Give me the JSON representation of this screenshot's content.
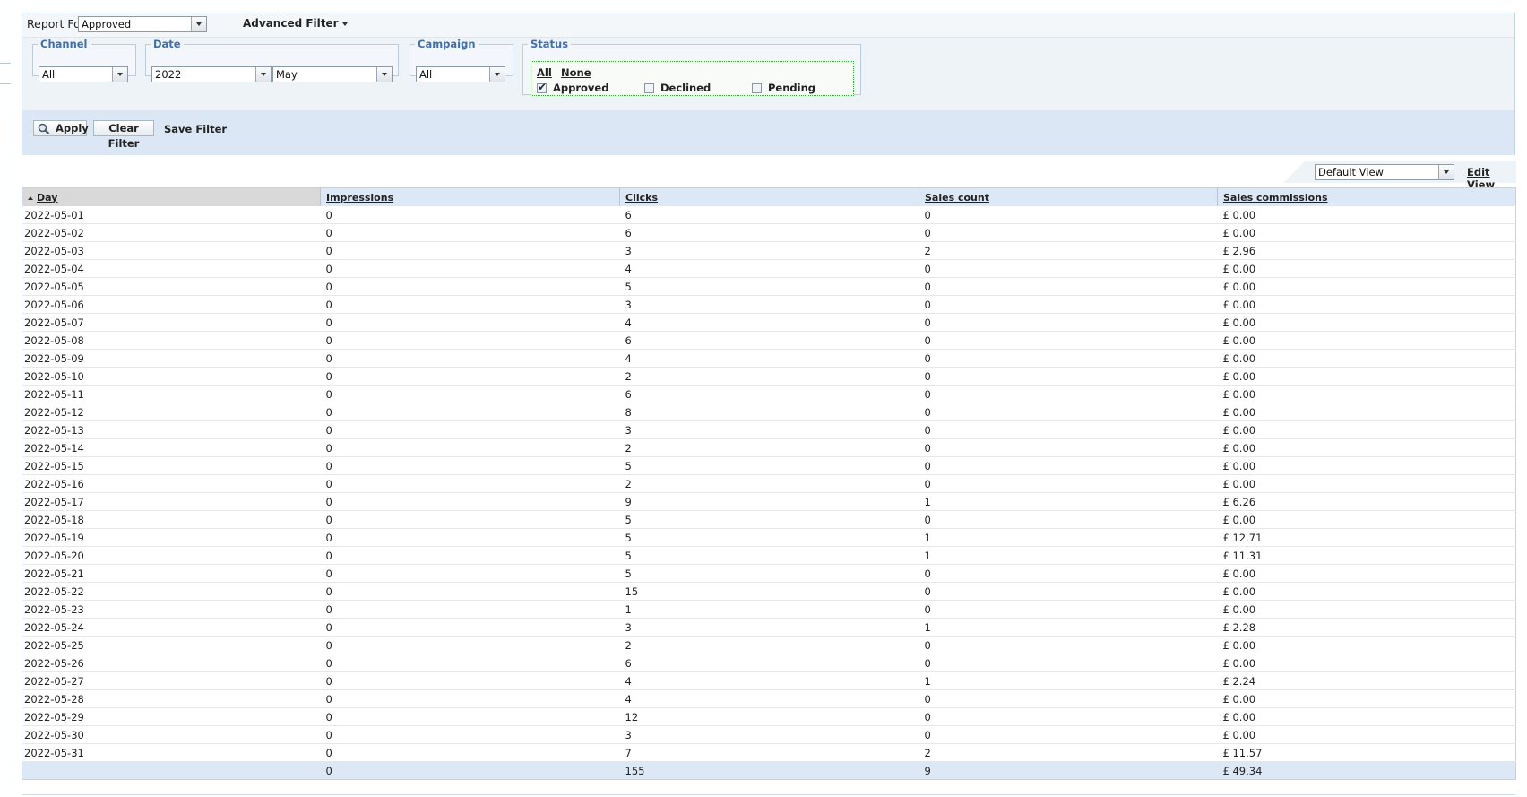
{
  "filter": {
    "report_for_label": "Report For",
    "report_for_value": "Approved",
    "advanced_filter_label": "Advanced Filter",
    "channel": {
      "legend": "Channel",
      "value": "All"
    },
    "date": {
      "legend": "Date",
      "year": "2022",
      "month": "May"
    },
    "campaign": {
      "legend": "Campaign",
      "value": "All"
    },
    "status": {
      "legend": "Status",
      "all_label": "All",
      "none_label": "None",
      "options": [
        {
          "label": "Approved",
          "checked": true
        },
        {
          "label": "Declined",
          "checked": false
        },
        {
          "label": "Pending",
          "checked": false
        }
      ]
    },
    "apply_label": "Apply",
    "clear_label": "Clear Filter",
    "save_label": "Save Filter"
  },
  "view": {
    "selected": "Default View",
    "edit_label": "Edit View"
  },
  "table": {
    "columns": [
      "Day",
      "Impressions",
      "Clicks",
      "Sales count",
      "Sales commissions"
    ],
    "rows": [
      [
        "2022-05-01",
        "0",
        "6",
        "0",
        "£ 0.00"
      ],
      [
        "2022-05-02",
        "0",
        "6",
        "0",
        "£ 0.00"
      ],
      [
        "2022-05-03",
        "0",
        "3",
        "2",
        "£ 2.96"
      ],
      [
        "2022-05-04",
        "0",
        "4",
        "0",
        "£ 0.00"
      ],
      [
        "2022-05-05",
        "0",
        "5",
        "0",
        "£ 0.00"
      ],
      [
        "2022-05-06",
        "0",
        "3",
        "0",
        "£ 0.00"
      ],
      [
        "2022-05-07",
        "0",
        "4",
        "0",
        "£ 0.00"
      ],
      [
        "2022-05-08",
        "0",
        "6",
        "0",
        "£ 0.00"
      ],
      [
        "2022-05-09",
        "0",
        "4",
        "0",
        "£ 0.00"
      ],
      [
        "2022-05-10",
        "0",
        "2",
        "0",
        "£ 0.00"
      ],
      [
        "2022-05-11",
        "0",
        "6",
        "0",
        "£ 0.00"
      ],
      [
        "2022-05-12",
        "0",
        "8",
        "0",
        "£ 0.00"
      ],
      [
        "2022-05-13",
        "0",
        "3",
        "0",
        "£ 0.00"
      ],
      [
        "2022-05-14",
        "0",
        "2",
        "0",
        "£ 0.00"
      ],
      [
        "2022-05-15",
        "0",
        "5",
        "0",
        "£ 0.00"
      ],
      [
        "2022-05-16",
        "0",
        "2",
        "0",
        "£ 0.00"
      ],
      [
        "2022-05-17",
        "0",
        "9",
        "1",
        "£ 6.26"
      ],
      [
        "2022-05-18",
        "0",
        "5",
        "0",
        "£ 0.00"
      ],
      [
        "2022-05-19",
        "0",
        "5",
        "1",
        "£ 12.71"
      ],
      [
        "2022-05-20",
        "0",
        "5",
        "1",
        "£ 11.31"
      ],
      [
        "2022-05-21",
        "0",
        "5",
        "0",
        "£ 0.00"
      ],
      [
        "2022-05-22",
        "0",
        "15",
        "0",
        "£ 0.00"
      ],
      [
        "2022-05-23",
        "0",
        "1",
        "0",
        "£ 0.00"
      ],
      [
        "2022-05-24",
        "0",
        "3",
        "1",
        "£ 2.28"
      ],
      [
        "2022-05-25",
        "0",
        "2",
        "0",
        "£ 0.00"
      ],
      [
        "2022-05-26",
        "0",
        "6",
        "0",
        "£ 0.00"
      ],
      [
        "2022-05-27",
        "0",
        "4",
        "1",
        "£ 2.24"
      ],
      [
        "2022-05-28",
        "0",
        "4",
        "0",
        "£ 0.00"
      ],
      [
        "2022-05-29",
        "0",
        "12",
        "0",
        "£ 0.00"
      ],
      [
        "2022-05-30",
        "0",
        "3",
        "0",
        "£ 0.00"
      ],
      [
        "2022-05-31",
        "0",
        "7",
        "2",
        "£ 11.57"
      ]
    ],
    "totals": [
      "",
      "0",
      "155",
      "9",
      "£ 49.34"
    ]
  }
}
